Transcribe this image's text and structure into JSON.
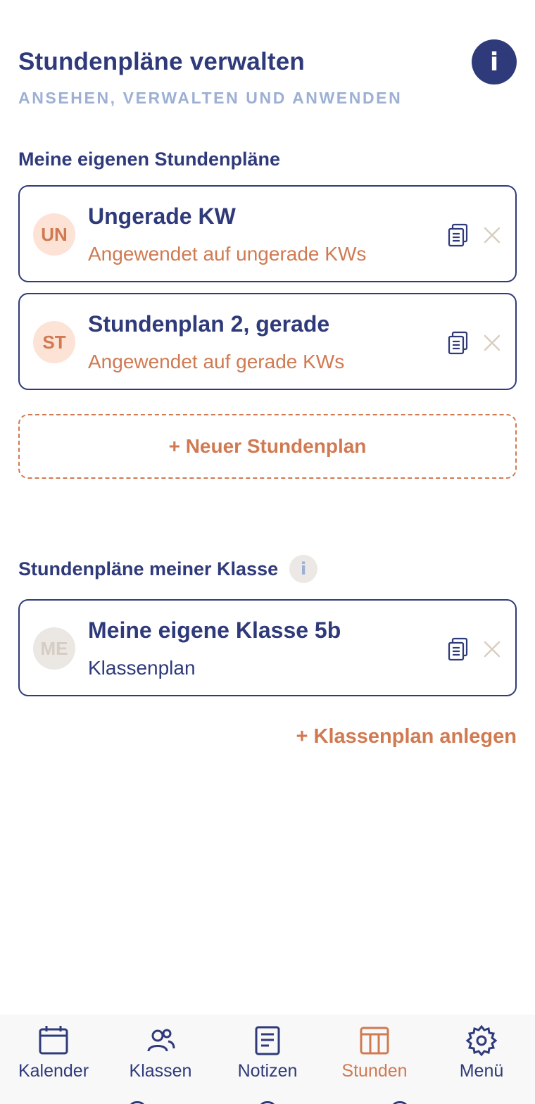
{
  "header": {
    "title": "Stundenpläne verwalten",
    "subtitle": "ANSEHEN, VERWALTEN UND ANWENDEN",
    "info_label": "i"
  },
  "own_section": {
    "title": "Meine eigenen Stundenpläne",
    "cards": [
      {
        "initials": "UN",
        "title": "Ungerade KW",
        "subtitle": "Angewendet auf ungerade KWs"
      },
      {
        "initials": "ST",
        "title": "Stundenplan 2, gerade",
        "subtitle": "Angewendet auf gerade KWs"
      }
    ],
    "new_button": "+ Neuer Stundenplan"
  },
  "class_section": {
    "title": "Stundenpläne meiner Klasse",
    "info_label": "i",
    "cards": [
      {
        "initials": "ME",
        "title": "Meine eigene Klasse 5b",
        "subtitle": "Klassenplan"
      }
    ],
    "add_link": "+ Klassenplan anlegen"
  },
  "bottom_nav": {
    "items": [
      {
        "label": "Kalender",
        "icon": "calendar-icon"
      },
      {
        "label": "Klassen",
        "icon": "users-icon"
      },
      {
        "label": "Notizen",
        "icon": "notes-icon"
      },
      {
        "label": "Stunden",
        "icon": "timetable-icon",
        "active": true
      },
      {
        "label": "Menü",
        "icon": "gear-icon"
      }
    ]
  },
  "colors": {
    "navy": "#2f3a7a",
    "accent": "#d07a52",
    "subtitle": "#9db0d4",
    "avatar_orange_bg": "#fde2d6",
    "avatar_grey_bg": "#ebe7e3"
  }
}
